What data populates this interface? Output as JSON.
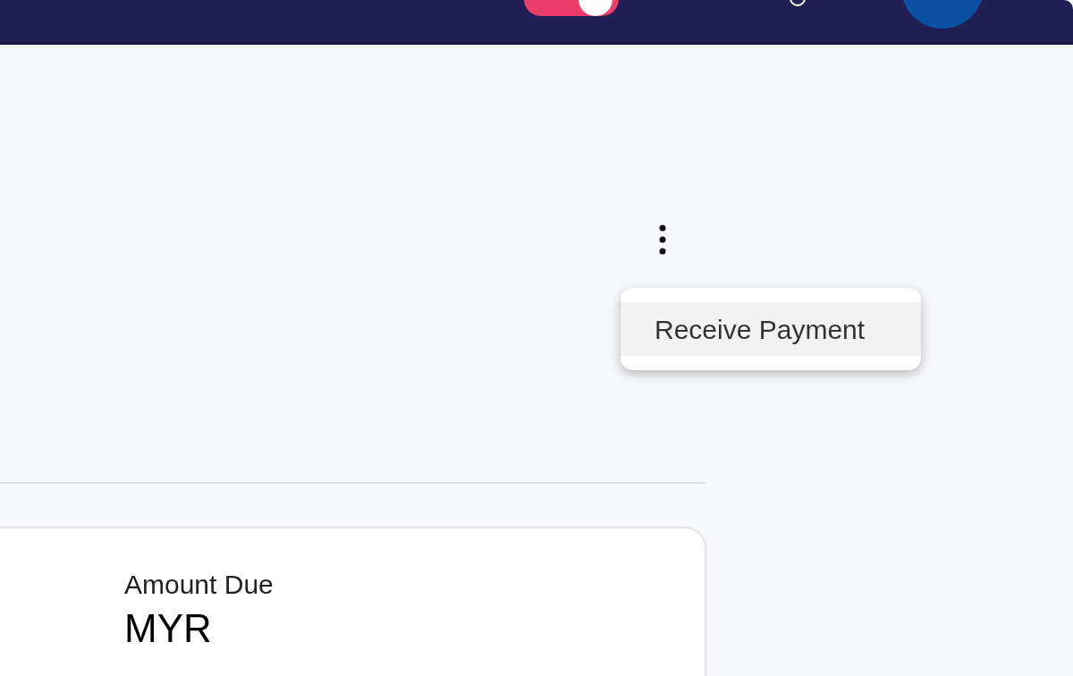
{
  "menu": {
    "items": [
      {
        "label": "Receive Payment",
        "selected": true
      }
    ]
  },
  "card": {
    "label": "Amount Due",
    "currency": "MYR"
  }
}
